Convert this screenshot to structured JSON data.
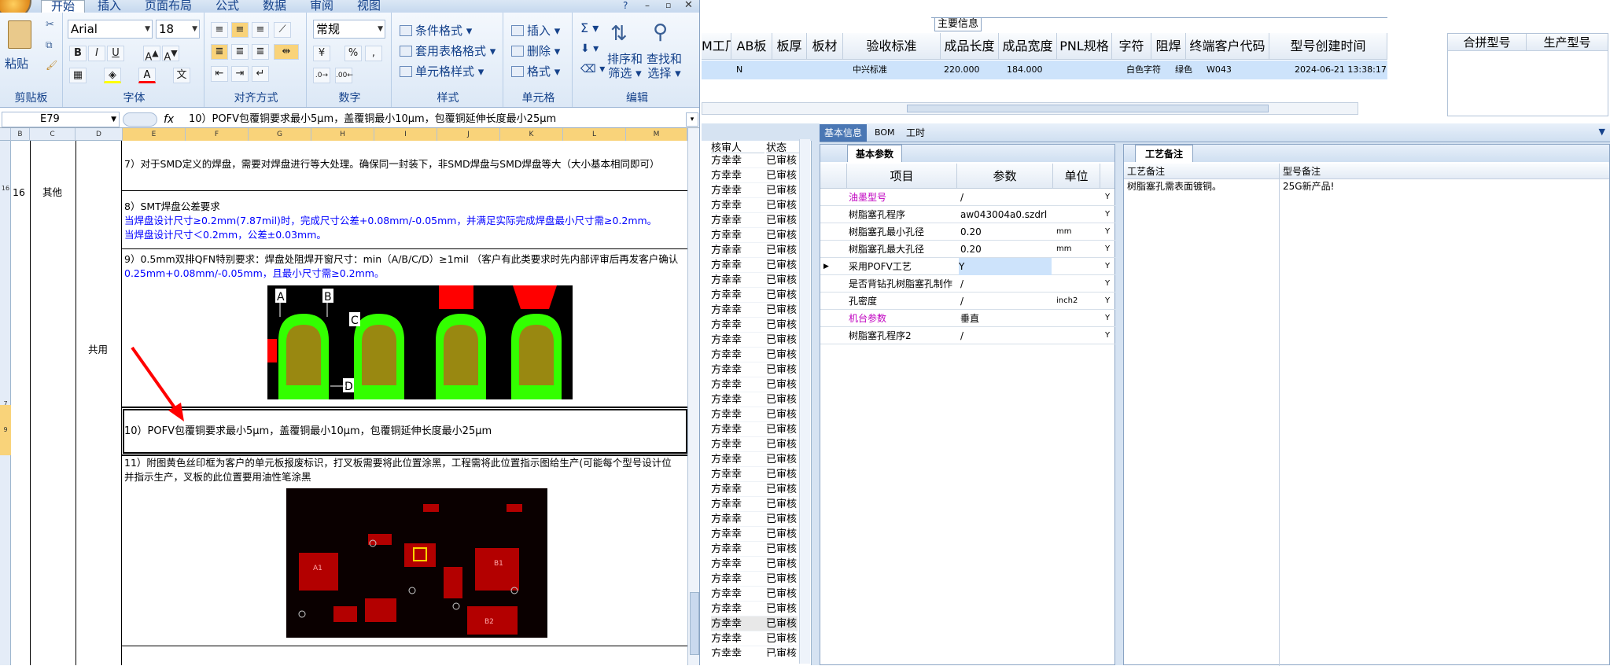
{
  "excel": {
    "tabs": [
      "开始",
      "插入",
      "页面布局",
      "公式",
      "数据",
      "审阅",
      "视图"
    ],
    "font_name": "Arial",
    "font_size": "18",
    "number_format": "常规",
    "commands": {
      "conditional_format": "条件格式",
      "table_format": "套用表格格式",
      "cell_style": "单元格样式",
      "insert": "插入",
      "delete": "删除",
      "format": "格式",
      "sort_filter_1": "排序和",
      "sort_filter_2": "筛选",
      "find_select_1": "查找和",
      "find_select_2": "选择",
      "paste": "粘贴",
      "bold": "B",
      "italic": "I",
      "underline": "U",
      "percent": "%"
    },
    "group_labels": [
      "剪贴板",
      "字体",
      "对齐方式",
      "数字",
      "样式",
      "单元格",
      "编辑"
    ],
    "name_box": "E79",
    "formula_icon": "fx",
    "formula": "10）POFV包覆铜要求最小5μm，盖覆铜最小10μm，包覆铜延伸长度最小25μm",
    "col_headers": [
      "B",
      "C",
      "D",
      "E",
      "F",
      "G",
      "H",
      "I",
      "J",
      "K",
      "L",
      "M"
    ],
    "row_numbers": [
      "16",
      "7",
      "8",
      "9"
    ],
    "cells": {
      "row_num": "16",
      "category": "其他",
      "shared": "共用",
      "item7": "7）对于SMD定义的焊盘，需要对焊盘进行等大处理。确保同一封装下，非SMD焊盘与SMD焊盘等大（大小基本相同即可）",
      "item8_title": "8）SMT焊盘公差要求",
      "item8_line1": "当焊盘设计尺寸≥0.2mm(7.87mil)时，完成尺寸公差+0.08mm/-0.05mm，并满足实际完成焊盘最小尺寸需≥0.2mm。",
      "item8_line2": "当焊盘设计尺寸＜0.2mm，公差±0.03mm。",
      "item9_line1": "9）0.5mm双排QFN特别要求：焊盘处阻焊开窗尺寸：min（A/B/C/D）≥1mil （客户有此类要求时先内部评审后再发客户确认",
      "item9_line2": "0.25mm+0.08mm/-0.05mm，且最小尺寸需≥0.2mm。",
      "item10": "10）POFV包覆铜要求最小5μm，盖覆铜最小10μm，包覆铜延伸长度最小25μm",
      "item11_line1": "11）附图黄色丝印框为客户的单元板报废标识，打叉板需要将此位置涂黑，工程需将此位置指示图给生产(可能每个型号设计位",
      "item11_line2": "并指示生产，叉板的此位置要用油性笔涂黑",
      "dim_labels": [
        "A",
        "B",
        "C",
        "D"
      ],
      "pcb_labels": [
        "A1",
        "B1",
        "B2"
      ]
    }
  },
  "top_grid": {
    "section_label": "主要信息",
    "headers": [
      "M工厂",
      "AB板",
      "板厚",
      "板材",
      "验收标准",
      "成品长度",
      "成品宽度",
      "PNL规格",
      "字符",
      "阻焊",
      "终端客户代码",
      "型号创建时间",
      "合拼型号",
      "生产型号"
    ],
    "row": {
      "ab": "N",
      "standard": "中兴标准",
      "length": "220.000",
      "width": "184.000",
      "char": "白色字符",
      "mask": "绿色",
      "customer": "W043",
      "created": "2024-06-21 13:38:17"
    }
  },
  "left_list": {
    "headers": [
      "核审人",
      "状态"
    ],
    "reviewer": "方幸幸",
    "status": "已审核",
    "row_count": 34
  },
  "detail": {
    "tabs": [
      "基本信息",
      "BOM",
      "工时"
    ],
    "params_tab": "基本参数",
    "notes_tab": "工艺备注",
    "param_headers": [
      "项目",
      "参数",
      "单位"
    ],
    "params": [
      {
        "item": "油墨型号",
        "value": "/",
        "unit": "",
        "flag": "Y",
        "highlight": true
      },
      {
        "item": "树脂塞孔程序",
        "value": "aw043004a0.szdrl",
        "unit": "",
        "flag": "Y",
        "highlight": false
      },
      {
        "item": "树脂塞孔最小孔径",
        "value": "0.20",
        "unit": "mm",
        "flag": "Y",
        "highlight": false
      },
      {
        "item": "树脂塞孔最大孔径",
        "value": "0.20",
        "unit": "mm",
        "flag": "Y",
        "highlight": false
      },
      {
        "item": "采用POFV工艺",
        "value": "Y",
        "unit": "",
        "flag": "Y",
        "highlight": false
      },
      {
        "item": "是否背钻孔树脂塞孔制作",
        "value": "/",
        "unit": "",
        "flag": "Y",
        "highlight": false
      },
      {
        "item": "孔密度",
        "value": "/",
        "unit": "inch2",
        "flag": "Y",
        "highlight": false
      },
      {
        "item": "机台参数",
        "value": "垂直",
        "unit": "",
        "flag": "Y",
        "highlight": true
      },
      {
        "item": "树脂塞孔程序2",
        "value": "/",
        "unit": "",
        "flag": "Y",
        "highlight": false
      }
    ],
    "note_headers": [
      "工艺备注",
      "型号备注"
    ],
    "process_note": "树脂塞孔需表面镀铜。",
    "model_note": "25G新产品!"
  },
  "colors": {
    "accent": "#15428b",
    "selection": "#cde3fb",
    "highlight_text": "#c000c0",
    "arrow": "#ff0000",
    "solder_green": "#33ff00",
    "pad_gold": "#998811"
  }
}
